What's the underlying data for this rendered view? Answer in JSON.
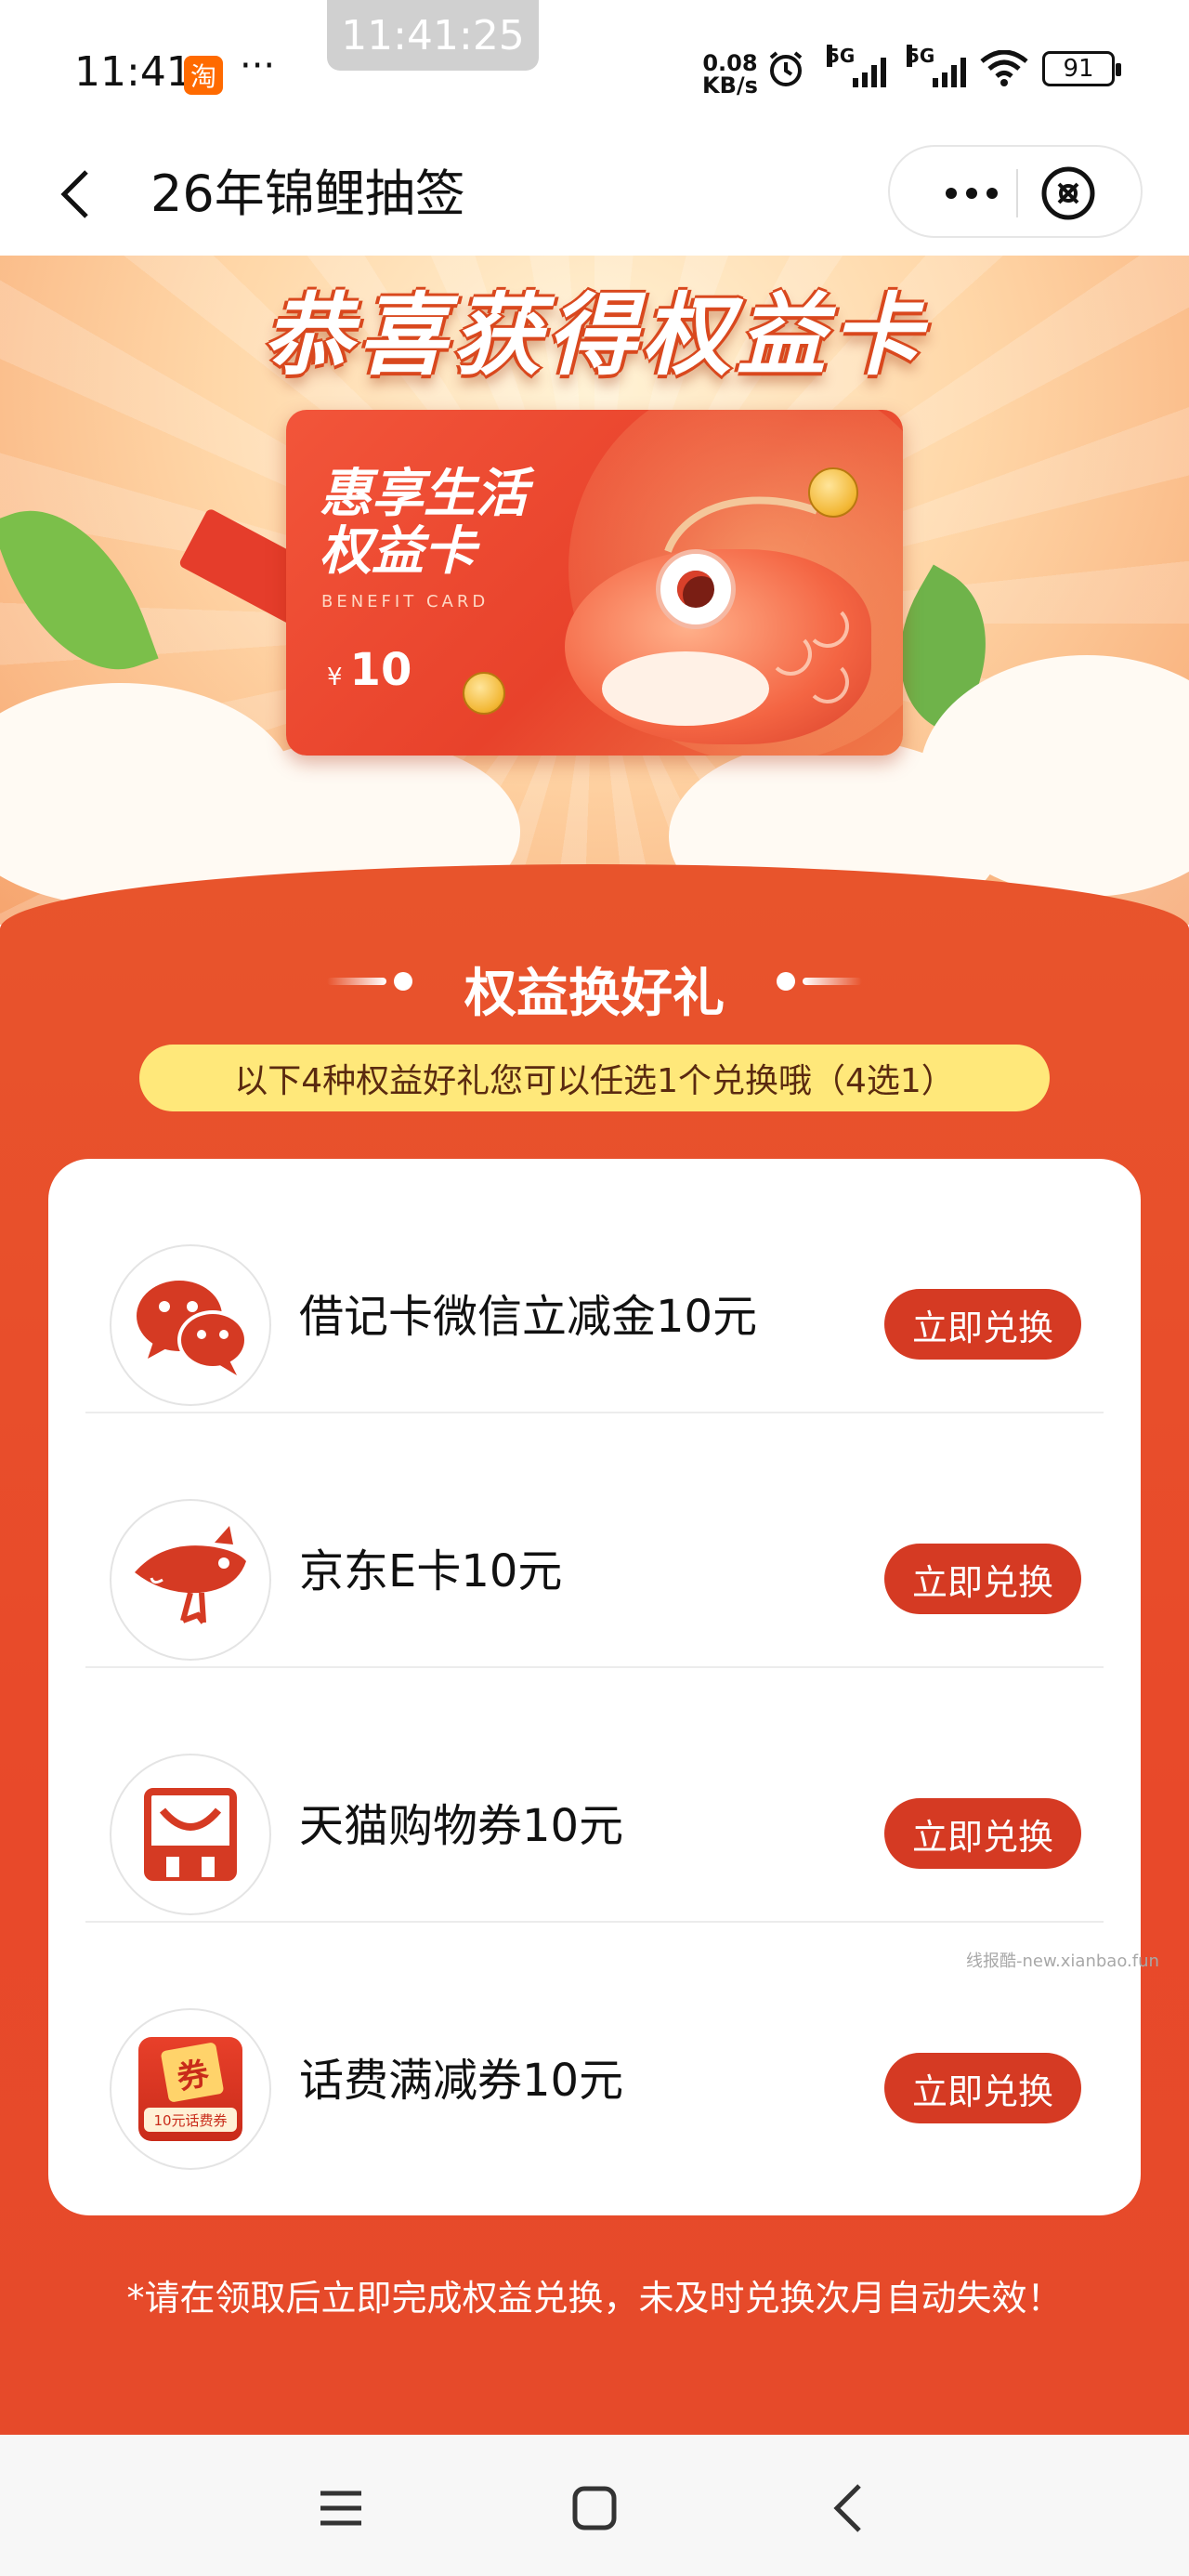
{
  "status_bar": {
    "time": "11:41",
    "app_badge": "淘",
    "more_dots": "···",
    "screenshot_time": "11:41:25",
    "net_speed_value": "0.08",
    "net_speed_unit": "KB/s",
    "signal_1_label": "5G",
    "signal_2_label": "5G",
    "battery": "91"
  },
  "nav": {
    "title": "26年锦鲤抽签"
  },
  "hero": {
    "headline": "恭喜获得权益卡",
    "card_title_line1": "惠享生活",
    "card_title_line2": "权益卡",
    "card_subtitle": "BENEFIT CARD",
    "card_currency": "¥",
    "card_amount": "10"
  },
  "section": {
    "title": "权益换好礼",
    "subtitle": "以下4种权益好礼您可以任选1个兑换哦（4选1）"
  },
  "rewards": [
    {
      "label": "借记卡微信立减金10元",
      "button": "立即兑换",
      "icon": "wechat-icon"
    },
    {
      "label": "京东E卡10元",
      "button": "立即兑换",
      "icon": "jd-icon"
    },
    {
      "label": "天猫购物券10元",
      "button": "立即兑换",
      "icon": "tmall-icon"
    },
    {
      "label": "话费满减券10元",
      "button": "立即兑换",
      "icon": "phone-coupon-icon",
      "icon_text_top": "券",
      "icon_text_bottom": "10元话费券"
    }
  ],
  "watermark": "线报酷-new.xianbao.fun",
  "footnote": "*请在领取后立即完成权益兑换，未及时兑换次月自动失效！",
  "colors": {
    "accent_red": "#d53a23",
    "section_bg": "#e8492a",
    "pill_yellow": "#ffe87a"
  }
}
